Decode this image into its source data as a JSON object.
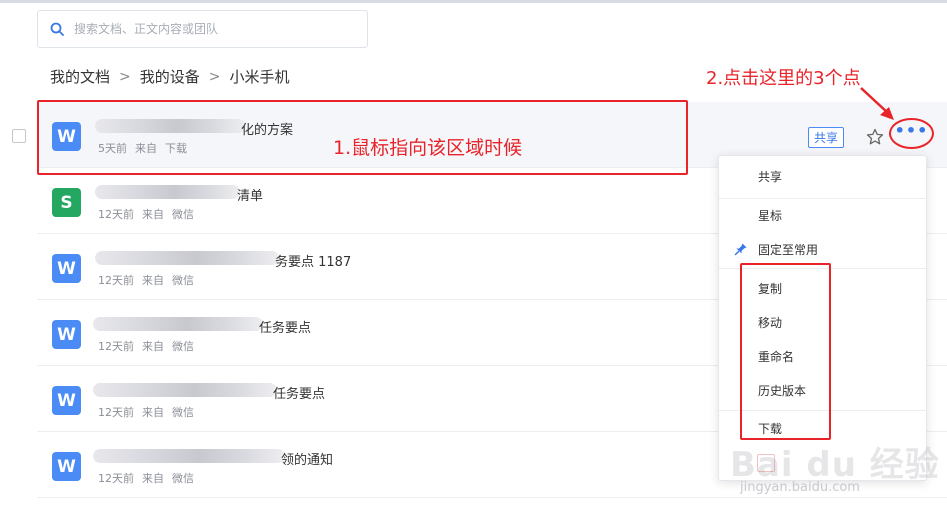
{
  "search": {
    "placeholder": "搜索文档、正文内容或团队",
    "icon": "search-icon"
  },
  "breadcrumb": [
    "我的文档",
    "我的设备",
    "小米手机"
  ],
  "annotations": {
    "step1": "1.鼠标指向该区域时候",
    "step2": "2.点击这里的3个点"
  },
  "files": [
    {
      "type": "W",
      "name": "化的方案",
      "prefix": "优",
      "time": "5天前",
      "source": "来自",
      "app": "下载"
    },
    {
      "type": "S",
      "name": "清单",
      "prefix": "",
      "time": "12天前",
      "source": "来自",
      "app": "微信"
    },
    {
      "type": "W",
      "name": "务要点 1187",
      "prefix": "",
      "time": "12天前",
      "source": "来自",
      "app": "微信"
    },
    {
      "type": "W",
      "name": "任务要点",
      "prefix": "",
      "time": "12天前",
      "source": "来自",
      "app": "微信"
    },
    {
      "type": "W",
      "name": "任务要点",
      "prefix": "",
      "time": "12天前",
      "source": "来自",
      "app": "微信"
    },
    {
      "type": "W",
      "name": "领的通知",
      "prefix": "",
      "time": "12天前",
      "source": "来自",
      "app": "微信"
    }
  ],
  "row_actions": {
    "share": "共享",
    "star_icon": "star-icon",
    "more_icon": "more-icon"
  },
  "menu": {
    "share": "共享",
    "star": "星标",
    "pin": "固定至常用",
    "copy": "复制",
    "move": "移动",
    "rename": "重命名",
    "history": "历史版本",
    "download": "下载"
  },
  "watermark": {
    "brand": "Bai du 经验",
    "url": "jingyan.baidu.com"
  },
  "colors": {
    "accent": "#4a8bf5",
    "annotation": "#e8242a",
    "sheet": "#24a760"
  }
}
